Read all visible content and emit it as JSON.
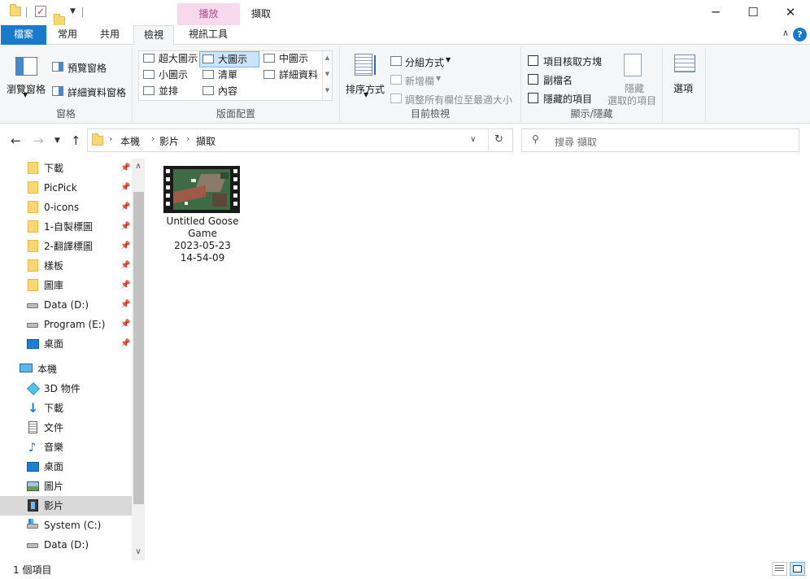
{
  "window": {
    "title": "擷取",
    "context_tab": "播放",
    "minimize": "─",
    "maximize": "☐",
    "close": "✕"
  },
  "ribbon_tabs": {
    "file": "檔案",
    "home": "常用",
    "share": "共用",
    "view": "檢視",
    "video_tools": "視訊工具"
  },
  "panes": {
    "navigation_pane": "瀏覽窗格",
    "preview_pane": "預覽窗格",
    "details_pane": "詳細資料窗格",
    "label": "窗格"
  },
  "layout": {
    "label": "版面配置",
    "items": [
      {
        "label": "超大圖示"
      },
      {
        "label": "大圖示",
        "selected": true
      },
      {
        "label": "中圖示"
      },
      {
        "label": "小圖示"
      },
      {
        "label": "清單"
      },
      {
        "label": "詳細資料"
      },
      {
        "label": "並排"
      },
      {
        "label": "內容"
      }
    ]
  },
  "current_view": {
    "label": "目前檢視",
    "sort_by": "排序方式",
    "group_by": "分組方式",
    "add_columns": "新增欄",
    "size_columns": "調整所有欄位至最適大小"
  },
  "show_hide": {
    "label": "顯示/隱藏",
    "item_checkboxes": "項目核取方塊",
    "file_extensions": "副檔名",
    "hidden_items": "隱藏的項目",
    "hide_selected_line1": "隱藏",
    "hide_selected_line2": "選取的項目",
    "options": "選項"
  },
  "address": {
    "segments": [
      "本機",
      "影片",
      "擷取"
    ],
    "search_placeholder": "搜尋 擷取"
  },
  "nav_pane": {
    "quick_access": [
      {
        "label": "下載",
        "pinned": true
      },
      {
        "label": "PicPick",
        "pinned": true
      },
      {
        "label": "0-icons",
        "pinned": true
      },
      {
        "label": "1-自製標圖",
        "pinned": true
      },
      {
        "label": "2-翻譯標圖",
        "pinned": true
      },
      {
        "label": "樣板",
        "pinned": true
      },
      {
        "label": "圖庫",
        "pinned": true
      },
      {
        "label": "Data (D:)",
        "pinned": true
      },
      {
        "label": "Program (E:)",
        "pinned": true
      },
      {
        "label": "桌面",
        "pinned": true
      }
    ],
    "this_pc": "本機",
    "this_pc_items": [
      {
        "label": "3D 物件"
      },
      {
        "label": "下載"
      },
      {
        "label": "文件"
      },
      {
        "label": "音樂"
      },
      {
        "label": "桌面"
      },
      {
        "label": "圖片"
      },
      {
        "label": "影片",
        "selected": true
      },
      {
        "label": "System (C:)"
      },
      {
        "label": "Data (D:)"
      }
    ]
  },
  "files": [
    {
      "name_line1": "Untitled Goose",
      "name_line2": "Game",
      "name_line3": "2023-05-23",
      "name_line4": "14-54-09"
    }
  ],
  "status": {
    "item_count": "1 個項目"
  }
}
